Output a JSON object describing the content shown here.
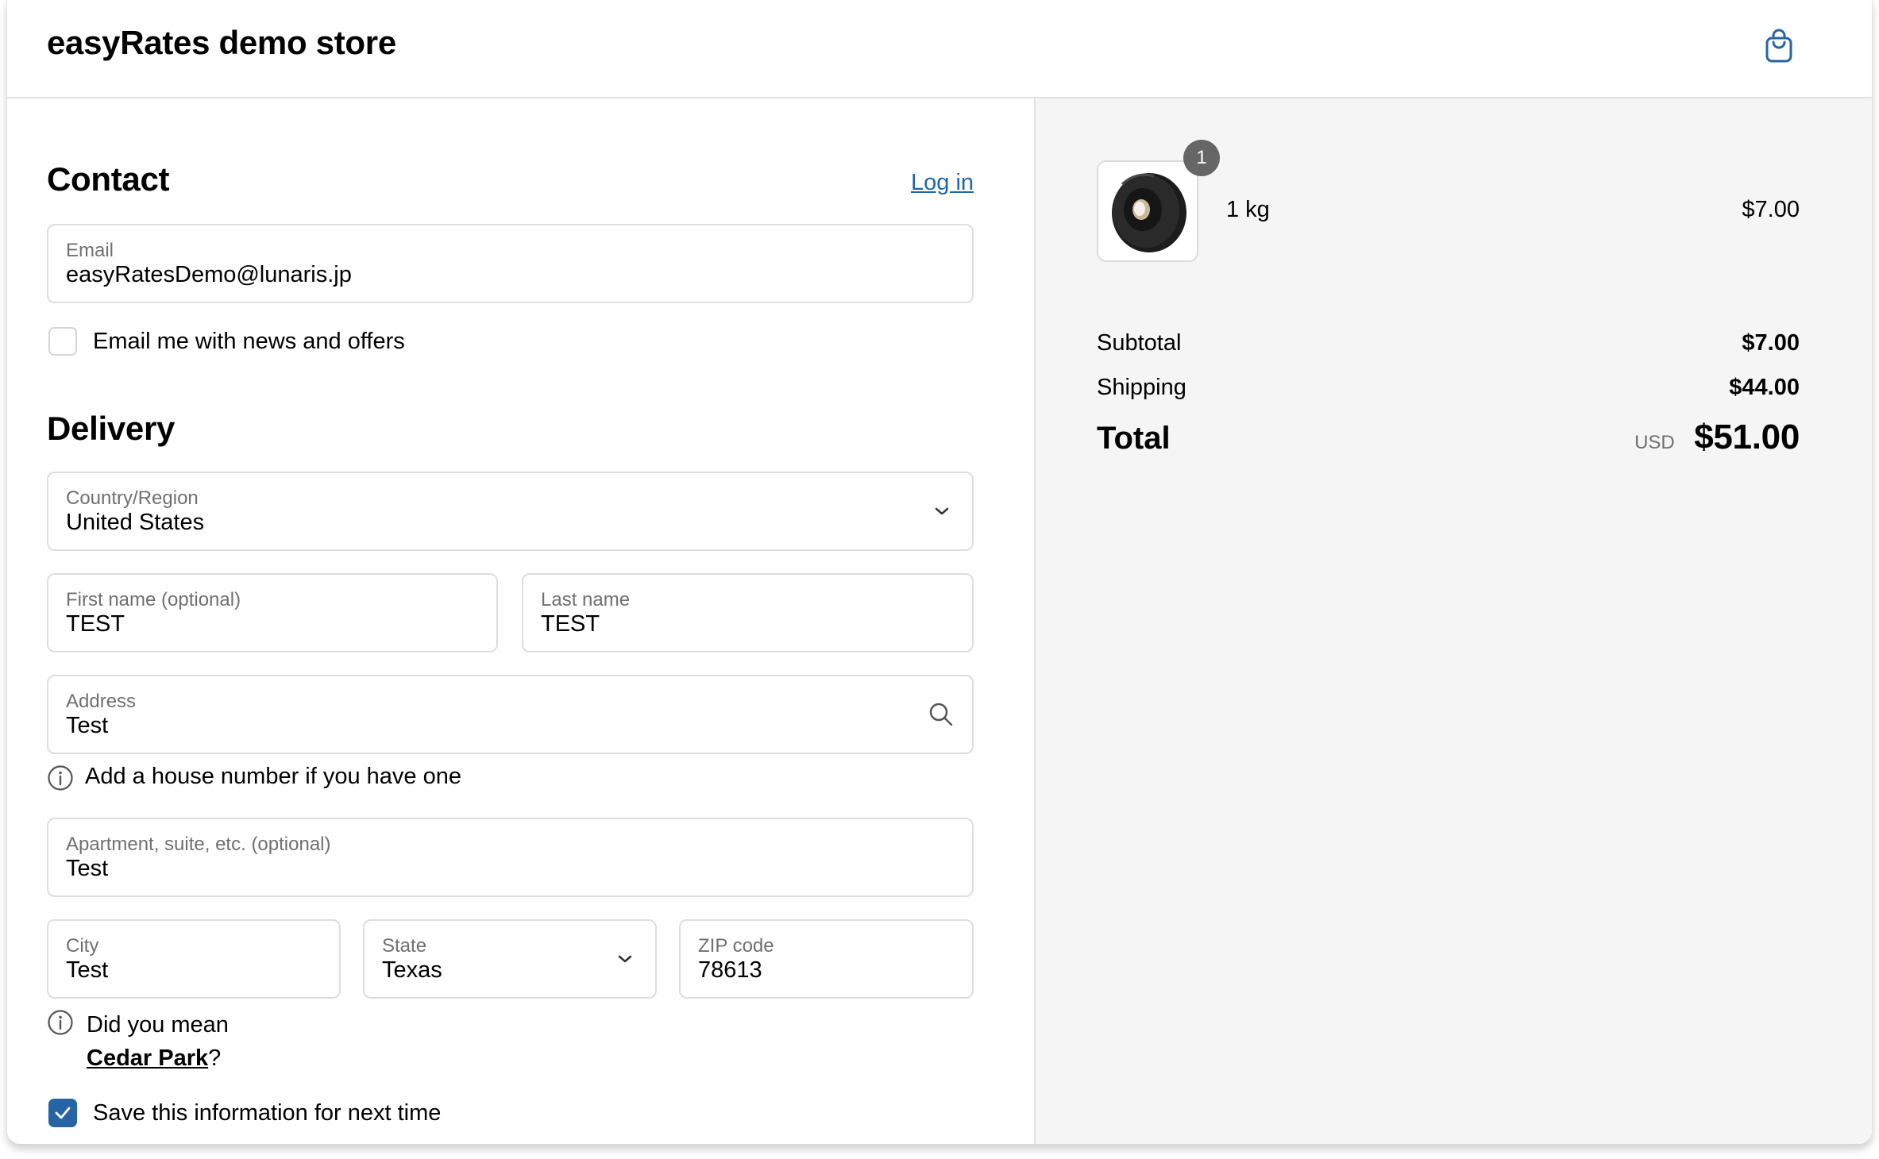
{
  "header": {
    "store_name": "easyRates demo store",
    "cart_icon": "shopping-bag-icon"
  },
  "contact": {
    "heading": "Contact",
    "login_link": "Log in",
    "email": {
      "label": "Email",
      "value": "easyRatesDemo@lunaris.jp"
    },
    "newsletter": {
      "label": "Email me with news and offers",
      "checked": false
    }
  },
  "delivery": {
    "heading": "Delivery",
    "country": {
      "label": "Country/Region",
      "value": "United States"
    },
    "first_name": {
      "label": "First name (optional)",
      "value": "TEST"
    },
    "last_name": {
      "label": "Last name",
      "value": "TEST"
    },
    "address": {
      "label": "Address",
      "value": "Test"
    },
    "address_hint": "Add a house number if you have one",
    "apartment": {
      "label": "Apartment, suite, etc. (optional)",
      "value": "Test"
    },
    "city": {
      "label": "City",
      "value": "Test"
    },
    "state": {
      "label": "State",
      "value": "Texas"
    },
    "zip": {
      "label": "ZIP code",
      "value": "78613"
    },
    "city_hint": {
      "prefix": "Did you mean",
      "suggestion": "Cedar Park",
      "suffix": "?"
    },
    "save_info": {
      "label": "Save this information for next time",
      "checked": true
    }
  },
  "summary": {
    "item": {
      "name": "1 kg",
      "price": "$7.00",
      "quantity": "1"
    },
    "subtotal": {
      "label": "Subtotal",
      "value": "$7.00"
    },
    "shipping": {
      "label": "Shipping",
      "value": "$44.00"
    },
    "total": {
      "label": "Total",
      "currency": "USD",
      "value": "$51.00"
    }
  },
  "colors": {
    "accent": "#2764a6",
    "link": "#1f66a8",
    "summary_bg": "#f5f5f5"
  }
}
